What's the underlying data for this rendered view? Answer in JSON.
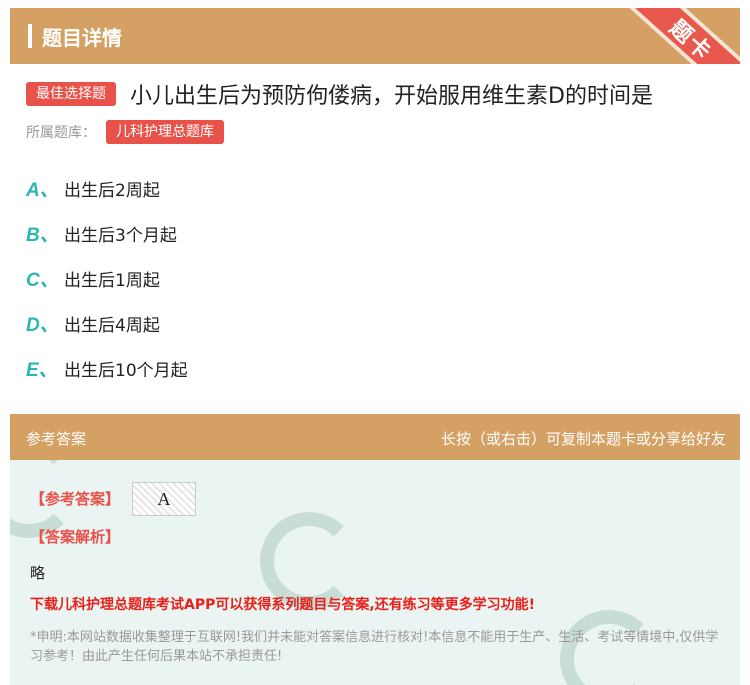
{
  "header": {
    "title": "题目详情",
    "ribbon": "题卡"
  },
  "question": {
    "type_tag": "最佳选择题",
    "text": "小儿出生后为预防佝偻病，开始服用维生素D的时间是",
    "bank_label": "所属题库：",
    "bank_name": "儿科护理总题库"
  },
  "options": [
    {
      "letter": "A、",
      "text": "出生后2周起"
    },
    {
      "letter": "B、",
      "text": "出生后3个月起"
    },
    {
      "letter": "C、",
      "text": "出生后1周起"
    },
    {
      "letter": "D、",
      "text": "出生后4周起"
    },
    {
      "letter": "E、",
      "text": "出生后10个月起"
    }
  ],
  "answer_section": {
    "header_left": "参考答案",
    "header_right": "长按（或右击）可复制本题卡或分享给好友",
    "answer_label": "【参考答案】",
    "answer_value": "A",
    "analysis_label": "【答案解析】",
    "analysis_text": "略",
    "download_text": "下载儿科护理总题库考试APP可以获得系列题目与答案,还有练习等更多学习功能!",
    "disclaimer": "*申明:本网站数据收集整理于互联网!我们并未能对答案信息进行核对!本信息不能用于生产、生活、考试等情境中,仅供学习参考！由此产生任何后果本站不承担责任!"
  },
  "colors": {
    "header_bg": "#d5a064",
    "tag_red": "#e8524a",
    "option_letter": "#2bb6b0",
    "answer_bg": "#eaf5f3"
  }
}
